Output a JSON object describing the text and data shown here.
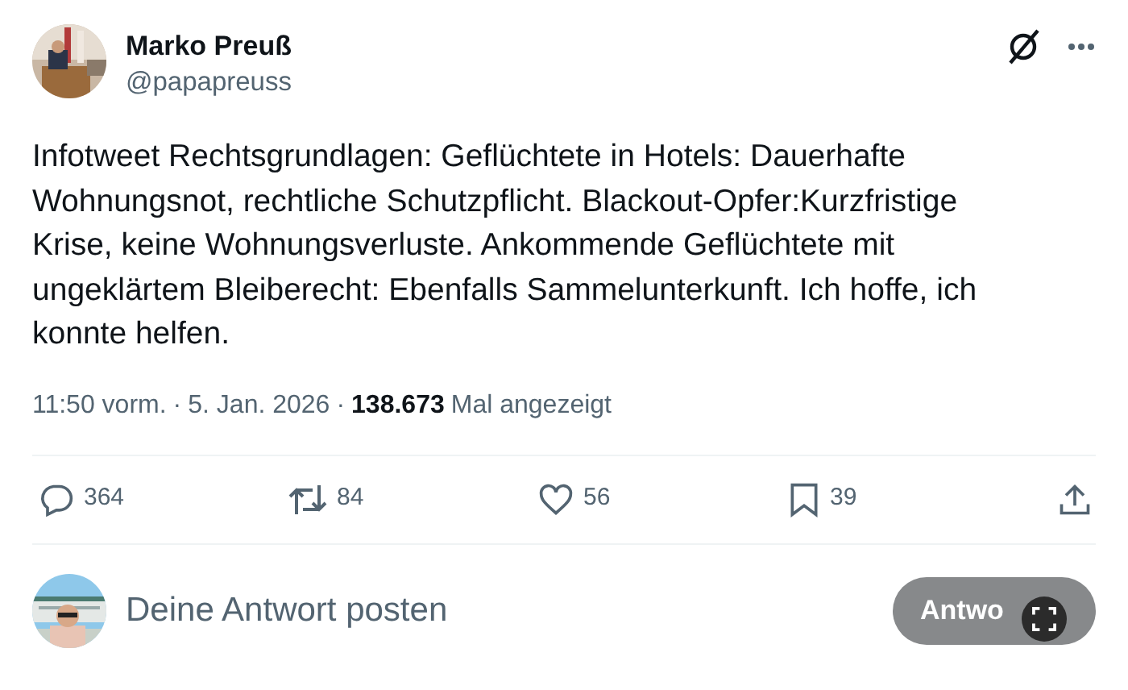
{
  "author": {
    "name": "Marko Preuß",
    "handle": "@papapreuss"
  },
  "text": "Infotweet Rechtsgrundlagen: Geflüchtete in Hotels: Dauerhafte Wohnungsnot, rechtliche Schutzpflicht. Blackout-Opfer:Kurzfristige Krise, keine Wohnungsverluste. Ankommende Geflüchtete mit ungeklärtem Bleiberecht: Ebenfalls Sammelunterkunft. Ich hoffe, ich konnte helfen.",
  "meta": {
    "time": "11:50 vorm.",
    "separator_1": "·",
    "date": "5. Jan. 2026",
    "separator_2": "·",
    "views": "138.673",
    "views_label": "Mal angezeigt"
  },
  "actions": [
    {
      "kind": "reply",
      "count": "364"
    },
    {
      "kind": "repost",
      "count": "84"
    },
    {
      "kind": "like",
      "count": "56"
    },
    {
      "kind": "bookmark",
      "count": "39"
    },
    {
      "kind": "share"
    }
  ],
  "reply_box": {
    "placeholder": "Deine Antwort posten",
    "button": "Antwo",
    "button_disabled": true
  }
}
